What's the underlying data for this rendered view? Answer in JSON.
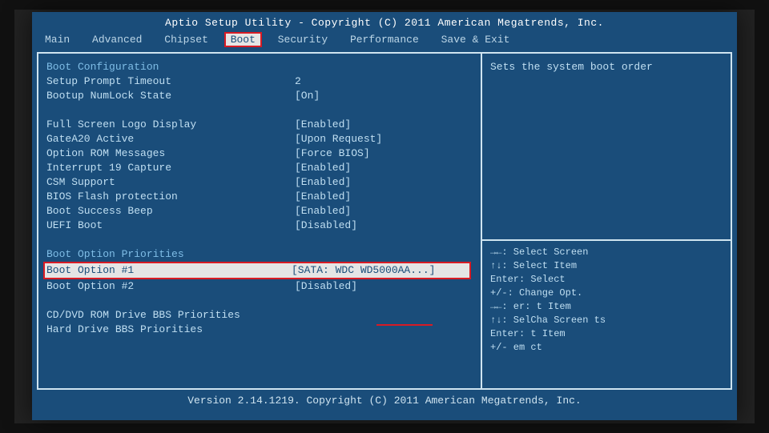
{
  "header": "Aptio Setup Utility - Copyright (C) 2011 American Megatrends, Inc.",
  "tabs": {
    "main": "Main",
    "advanced": "Advanced",
    "chipset": "Chipset",
    "boot": "Boot",
    "security": "Security",
    "performance": "Performance",
    "saveexit": "Save & Exit"
  },
  "left": {
    "boot_config_title": "Boot Configuration",
    "setup_prompt_timeout_label": "Setup Prompt Timeout",
    "setup_prompt_timeout_value": "2",
    "bootup_numlock_label": "Bootup NumLock State",
    "bootup_numlock_value": "[On]",
    "fullscreen_logo_label": "Full Screen Logo Display",
    "fullscreen_logo_value": "[Enabled]",
    "gatea20_label": "GateA20 Active",
    "gatea20_value": "[Upon Request]",
    "option_rom_label": "Option ROM Messages",
    "option_rom_value": "[Force BIOS]",
    "int19_label": "Interrupt 19 Capture",
    "int19_value": "[Enabled]",
    "csm_label": "CSM Support",
    "csm_value": "[Enabled]",
    "bios_flash_label": "BIOS Flash protection",
    "bios_flash_value": "[Enabled]",
    "boot_beep_label": "Boot Success Beep",
    "boot_beep_value": "[Enabled]",
    "uefi_boot_label": "UEFI Boot",
    "uefi_boot_value": "[Disabled]",
    "priorities_title": "Boot Option Priorities",
    "boot1_label": "Boot Option #1",
    "boot1_value": "[SATA: WDC WD5000AA...]",
    "boot2_label": "Boot Option #2",
    "boot2_value": "[Disabled]",
    "cddvd_label": "CD/DVD ROM Drive BBS Priorities",
    "hdd_label": "Hard Drive BBS Priorities"
  },
  "right": {
    "desc": "Sets the system boot order",
    "help1": "→←: Select Screen",
    "help2": "↑↓: Select Item",
    "help3": "Enter: Select",
    "help4": "+/-: Change Opt.",
    "help5": "→←: er:  t Item",
    "help6": "↑↓: SelCha Screen    ts",
    "help7": "Enter:   t Item",
    "help8": "+/-    em  ct"
  },
  "footer": "Version 2.14.1219. Copyright (C) 2011 American Megatrends, Inc."
}
